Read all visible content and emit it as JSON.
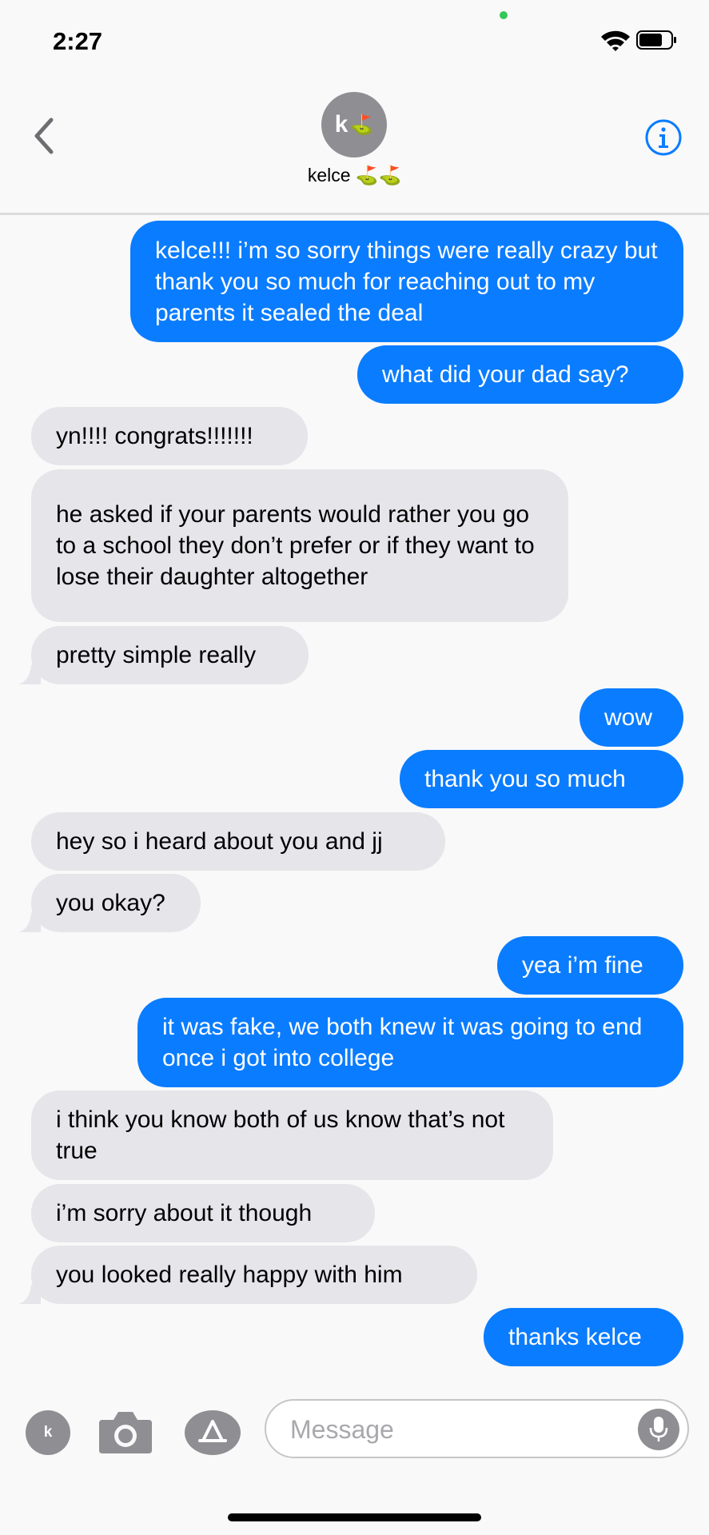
{
  "status_bar": {
    "time": "2:27",
    "icons": [
      "wifi-icon",
      "battery-icon"
    ]
  },
  "header": {
    "avatar_initial": "k",
    "avatar_emoji": "⛳",
    "contact_name": "kelce ⛳⛳",
    "icons": [
      "chevron-left-icon",
      "info-icon"
    ]
  },
  "messages": [
    {
      "dir": "out",
      "text": "kelce!!! i’m so sorry things were really crazy but thank you so much for reaching out to my parents it sealed the deal"
    },
    {
      "dir": "out",
      "text": "what did your dad say?"
    },
    {
      "dir": "in",
      "text": "yn!!!! congrats!!!!!!!"
    },
    {
      "dir": "in",
      "text": "he asked if your parents would rather you go to a school they don’t prefer or if they want to lose their daughter altogether"
    },
    {
      "dir": "in",
      "text": "pretty simple really"
    },
    {
      "dir": "out",
      "text": "wow"
    },
    {
      "dir": "out",
      "text": "thank you so much"
    },
    {
      "dir": "in",
      "text": "hey so i heard about you and jj"
    },
    {
      "dir": "in",
      "text": "you okay?"
    },
    {
      "dir": "out",
      "text": "yea i’m fine"
    },
    {
      "dir": "out",
      "text": "it was fake, we both knew it was going to end once i got into college"
    },
    {
      "dir": "in",
      "text": "i think you know both of us know that’s not true"
    },
    {
      "dir": "in",
      "text": "i’m sorry about it though"
    },
    {
      "dir": "in",
      "text": "you looked really happy with him"
    },
    {
      "dir": "out",
      "text": "thanks kelce"
    }
  ],
  "compose": {
    "placeholder": "Message",
    "app_avatar_initial": "k",
    "icons": [
      "memoji-icon",
      "camera-icon",
      "app-store-icon",
      "microphone-icon"
    ]
  },
  "colors": {
    "outgoing_bubble": "#0a7cff",
    "incoming_bubble": "#e5e5ea",
    "accent": "#0a7cff"
  }
}
